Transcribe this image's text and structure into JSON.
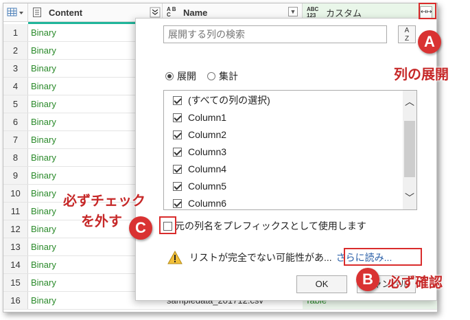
{
  "header": {
    "col_content": "Content",
    "col_name": "Name",
    "col_custom": "カスタム",
    "col_name_type": "A B C",
    "col_custom_type": "ABC 123"
  },
  "rows": [
    {
      "n": "1",
      "v": "Binary"
    },
    {
      "n": "2",
      "v": "Binary"
    },
    {
      "n": "3",
      "v": "Binary"
    },
    {
      "n": "4",
      "v": "Binary"
    },
    {
      "n": "5",
      "v": "Binary"
    },
    {
      "n": "6",
      "v": "Binary"
    },
    {
      "n": "7",
      "v": "Binary"
    },
    {
      "n": "8",
      "v": "Binary"
    },
    {
      "n": "9",
      "v": "Binary"
    },
    {
      "n": "10",
      "v": "Binary"
    },
    {
      "n": "11",
      "v": "Binary"
    },
    {
      "n": "12",
      "v": "Binary"
    },
    {
      "n": "13",
      "v": "Binary"
    },
    {
      "n": "14",
      "v": "Binary"
    },
    {
      "n": "15",
      "v": "Binary"
    },
    {
      "n": "16",
      "v": "Binary"
    }
  ],
  "row16_name": "sampledata_201712.csv",
  "row16_custom": "Table",
  "popup": {
    "search_placeholder": "展開する列の検索",
    "sort_label_top": "A",
    "sort_label_bottom": "Z",
    "radio_expand": "展開",
    "radio_aggregate": "集計",
    "columns": [
      "(すべての列の選択)",
      "Column1",
      "Column2",
      "Column3",
      "Column4",
      "Column5",
      "Column6"
    ],
    "prefix_label": "元の列名をプレフィックスとして使用します",
    "warning": "リストが完全でない可能性があ...",
    "load_more": "さらに読み...",
    "ok": "OK",
    "cancel": "キャンセル"
  },
  "annotations": {
    "a": "A",
    "a_text": "列の展開",
    "b": "B",
    "b_text": "必ず確認",
    "c": "C",
    "c_text_1": "必ずチェック",
    "c_text_2": "を外す"
  },
  "colors": {
    "accent_red": "#d93232",
    "teal": "#1fb59a",
    "binary_green": "#2a8a2a",
    "link_blue": "#2a5fa8"
  }
}
